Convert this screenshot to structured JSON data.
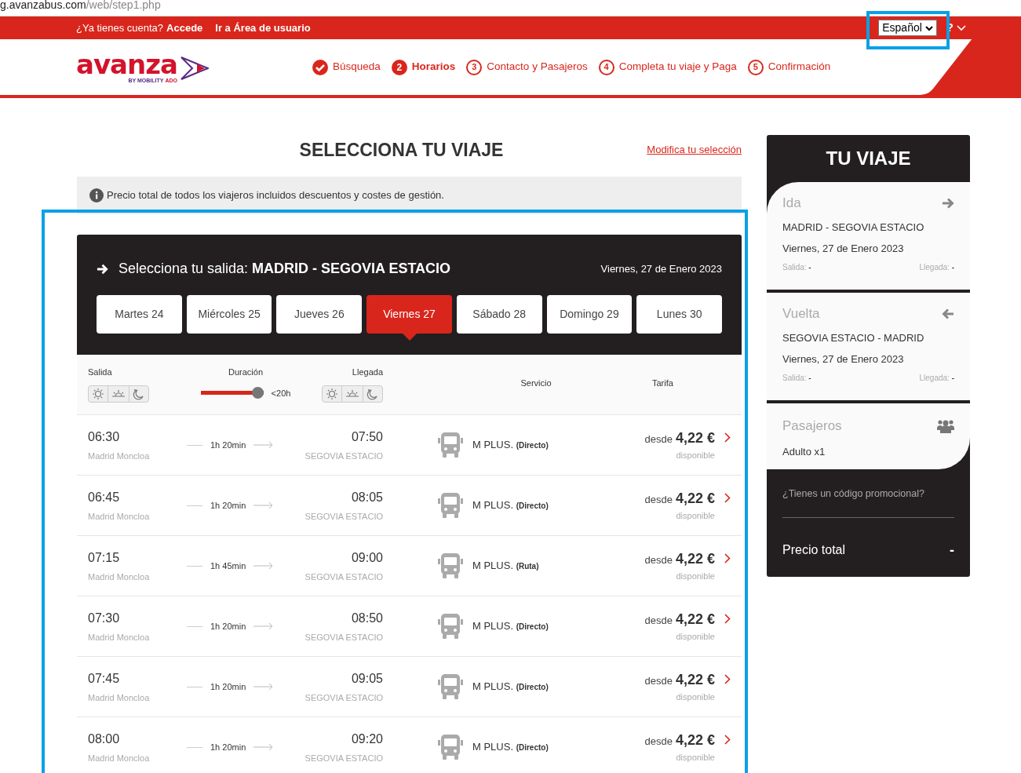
{
  "address_bar": {
    "host": "g.avanzabus.com",
    "path": "/web/step1.php"
  },
  "logo": {
    "wordmark": "avanza",
    "byline": "BY MOBILITY",
    "byline_brand": "ADO"
  },
  "top_bar": {
    "prompt": "¿Ya tienes cuenta?",
    "login_link": "Accede",
    "user_area_link": "Ir a Área de usuario",
    "language": "Español",
    "help": "?"
  },
  "steps": [
    {
      "label": "Búsqueda",
      "kind": "done"
    },
    {
      "number": "2",
      "label": "Horarios",
      "kind": "current"
    },
    {
      "number": "3",
      "label": "Contacto y Pasajeros",
      "kind": "todo"
    },
    {
      "number": "4",
      "label": "Completa tu viaje y Paga",
      "kind": "todo"
    },
    {
      "number": "5",
      "label": "Confirmación",
      "kind": "todo"
    }
  ],
  "page_title": "SELECCIONA TU VIAJE",
  "modify_link": "Modifica tu selección",
  "info_note": "Precio total de todos los viajeros incluidos descuentos y costes de gestión.",
  "departure": {
    "prefix": "Selecciona tu salida:",
    "route": "MADRID - SEGOVIA ESTACIO",
    "date": "Viernes, 27 de Enero 2023",
    "days": [
      {
        "label": "Martes 24",
        "selected": false
      },
      {
        "label": "Miércoles 25",
        "selected": false
      },
      {
        "label": "Jueves 26",
        "selected": false
      },
      {
        "label": "Viernes 27",
        "selected": true
      },
      {
        "label": "Sábado 28",
        "selected": false
      },
      {
        "label": "Domingo 29",
        "selected": false
      },
      {
        "label": "Lunes 30",
        "selected": false
      }
    ]
  },
  "filters": {
    "departure_label": "Salida",
    "duration_label": "Duración",
    "duration_slider": {
      "level": 1
    },
    "duration_value": "<20h",
    "arrival_label": "Llegada",
    "service_label": "Servicio",
    "fare_label": "Tarifa"
  },
  "trips": [
    {
      "depart": "06:30",
      "origin": "Madrid Moncloa",
      "duration": "1h 20min",
      "arrive": "07:50",
      "destination": "SEGOVIA ESTACIO",
      "service": "M PLUS.",
      "service_type": "(Directo)",
      "from": "desde",
      "price": "4,22 €",
      "availability": "disponible"
    },
    {
      "depart": "06:45",
      "origin": "Madrid Moncloa",
      "duration": "1h 20min",
      "arrive": "08:05",
      "destination": "SEGOVIA ESTACIO",
      "service": "M PLUS.",
      "service_type": "(Directo)",
      "from": "desde",
      "price": "4,22 €",
      "availability": "disponible"
    },
    {
      "depart": "07:15",
      "origin": "Madrid Moncloa",
      "duration": "1h 45min",
      "arrive": "09:00",
      "destination": "SEGOVIA ESTACIO",
      "service": "M PLUS.",
      "service_type": "(Ruta)",
      "from": "desde",
      "price": "4,22 €",
      "availability": "disponible"
    },
    {
      "depart": "07:30",
      "origin": "Madrid Moncloa",
      "duration": "1h 20min",
      "arrive": "08:50",
      "destination": "SEGOVIA ESTACIO",
      "service": "M PLUS.",
      "service_type": "(Directo)",
      "from": "desde",
      "price": "4,22 €",
      "availability": "disponible"
    },
    {
      "depart": "07:45",
      "origin": "Madrid Moncloa",
      "duration": "1h 20min",
      "arrive": "09:05",
      "destination": "SEGOVIA ESTACIO",
      "service": "M PLUS.",
      "service_type": "(Directo)",
      "from": "desde",
      "price": "4,22 €",
      "availability": "disponible"
    },
    {
      "depart": "08:00",
      "origin": "Madrid Moncloa",
      "duration": "1h 20min",
      "arrive": "09:20",
      "destination": "SEGOVIA ESTACIO",
      "service": "M PLUS.",
      "service_type": "(Directo)",
      "from": "desde",
      "price": "4,22 €",
      "availability": "disponible"
    }
  ],
  "summary": {
    "title": "TU VIAJE",
    "legs": [
      {
        "kind": "outbound",
        "label": "Ida",
        "route": "MADRID - SEGOVIA ESTACIO",
        "date": "Viernes, 27 de Enero 2023",
        "departure_label": "Salida:",
        "departure_value": "-",
        "arrival_label": "Llegada:",
        "arrival_value": "-"
      },
      {
        "kind": "return",
        "label": "Vuelta",
        "route": "SEGOVIA ESTACIO - MADRID",
        "date": "Viernes, 27 de Enero 2023",
        "departure_label": "Salida:",
        "departure_value": "-",
        "arrival_label": "Llegada:",
        "arrival_value": "-"
      }
    ],
    "passengers_label": "Pasajeros",
    "passengers": "Adulto x1",
    "promo_link": "¿Tienes un código promocional?",
    "total_label": "Precio total",
    "total_value": "-"
  }
}
